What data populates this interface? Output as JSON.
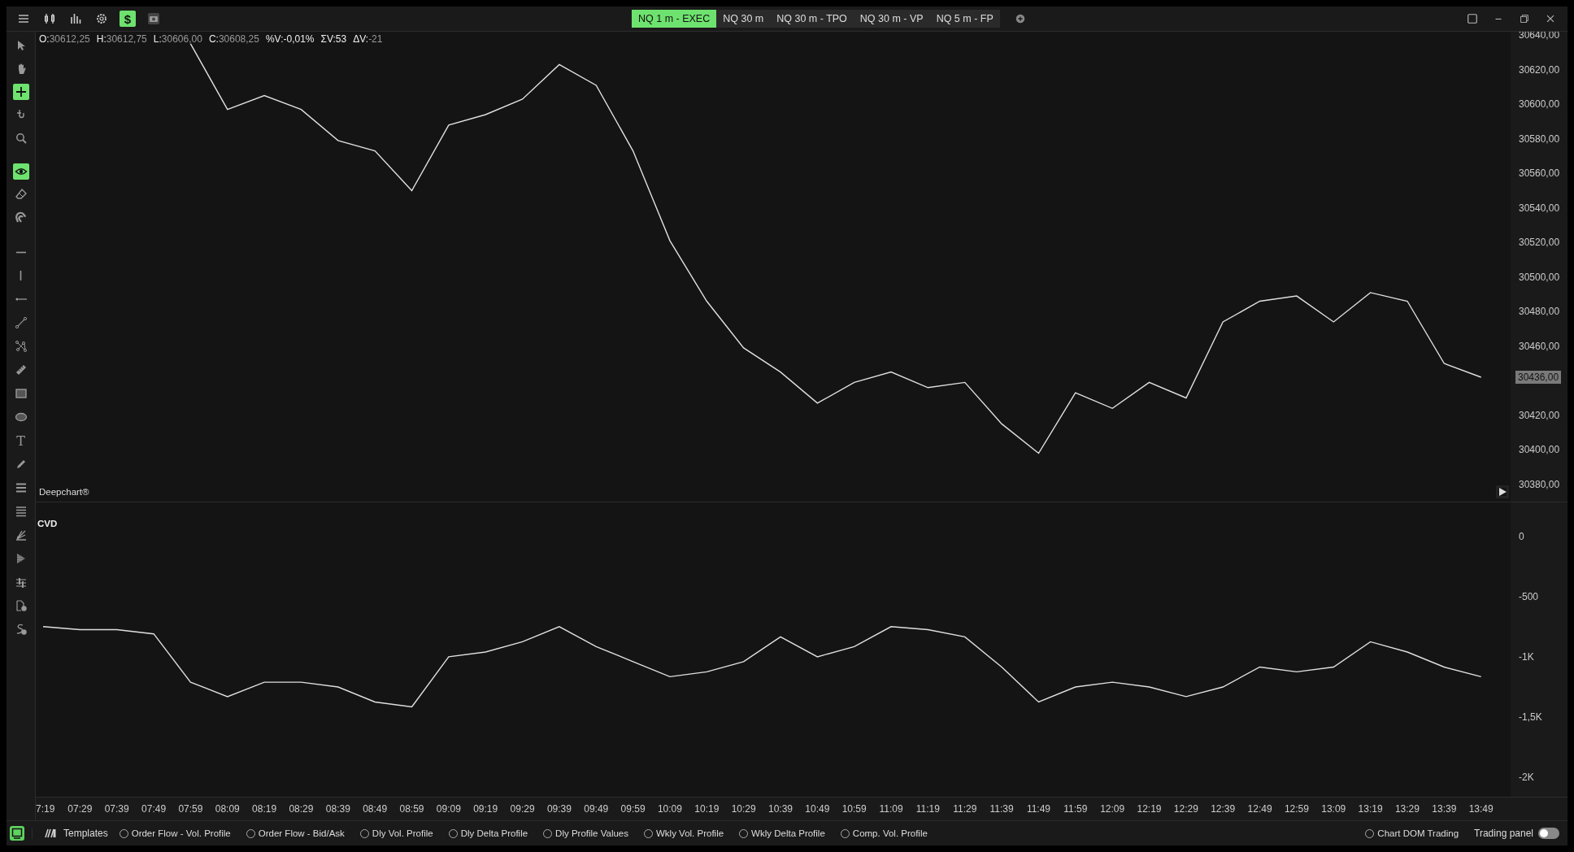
{
  "toolbar": {
    "buttons": [
      {
        "kind": "menu",
        "selected": false
      },
      {
        "kind": "candles",
        "selected": false
      },
      {
        "kind": "bars",
        "selected": false
      },
      {
        "kind": "gear",
        "selected": false
      },
      {
        "kind": "glyph",
        "glyph": "$",
        "selected": true
      },
      {
        "kind": "camera",
        "selected": false
      }
    ]
  },
  "tabs": [
    {
      "label": "NQ 1 m - EXEC",
      "selected": true
    },
    {
      "label": "NQ 30 m",
      "selected": false
    },
    {
      "label": "NQ 30 m - TPO",
      "selected": false
    },
    {
      "label": "NQ 30 m - VP",
      "selected": false
    },
    {
      "label": "NQ 5 m - FP",
      "selected": false
    }
  ],
  "tools": [
    [
      {
        "kind": "pointer",
        "selected": false
      },
      {
        "kind": "hand",
        "selected": false
      },
      {
        "kind": "crosshair",
        "selected": true
      },
      {
        "kind": "hook",
        "selected": false
      },
      {
        "kind": "zoom",
        "selected": false
      }
    ],
    [
      {
        "kind": "eye",
        "selected": true
      },
      {
        "kind": "eraser",
        "selected": false
      },
      {
        "kind": "magnet",
        "selected": false
      }
    ],
    [
      {
        "kind": "hline",
        "selected": false
      },
      {
        "kind": "vline",
        "selected": false
      },
      {
        "kind": "ray",
        "selected": false
      },
      {
        "kind": "trendline",
        "selected": false
      },
      {
        "kind": "polyline",
        "selected": false
      },
      {
        "kind": "ruler",
        "selected": false
      },
      {
        "kind": "rectangle",
        "selected": false
      },
      {
        "kind": "ellipse",
        "selected": false
      },
      {
        "kind": "glyph",
        "glyph": "T",
        "selected": false
      },
      {
        "kind": "pencil",
        "selected": false
      },
      {
        "kind": "lines",
        "selected": false
      },
      {
        "kind": "lines4",
        "selected": false
      },
      {
        "kind": "fan",
        "selected": false
      },
      {
        "kind": "flag",
        "selected": false
      },
      {
        "kind": "levels",
        "selected": false
      },
      {
        "kind": "doc",
        "selected": false
      },
      {
        "kind": "curve",
        "selected": false
      }
    ]
  ],
  "legend": [
    {
      "label": "O:",
      "value": "30612,25",
      "bright": false
    },
    {
      "label": "H:",
      "value": "30612,75",
      "bright": false
    },
    {
      "label": "L:",
      "value": "30606,00",
      "bright": false
    },
    {
      "label": "C:",
      "value": "30608,25",
      "bright": false
    },
    {
      "label": "%V:",
      "value": "-0,01%",
      "bright": true
    },
    {
      "label": "ΣV:",
      "value": "53",
      "bright": true
    },
    {
      "label": "ΔV:",
      "value": "-21",
      "bright": false
    }
  ],
  "price_pane": {
    "title": "Deepchart®",
    "current_price": "30436,00",
    "chart_data": {
      "type": "line",
      "series": [
        {
          "color": "#e0e0e0",
          "values": [
            null,
            null,
            null,
            null,
            30635,
            30597,
            30605,
            30597,
            30579,
            30573,
            30550,
            30588,
            30594,
            30603,
            30623,
            30611,
            30573,
            30521,
            30486,
            30459,
            30445,
            30427,
            30439,
            30445,
            30436,
            30439,
            30415,
            30398,
            30433,
            30424,
            30439,
            30430,
            30474,
            30486,
            30489,
            30474,
            30491,
            30486,
            30450,
            30442
          ]
        }
      ],
      "ylim": [
        30370,
        30642
      ],
      "yticks": [
        {
          "value": 30640,
          "label": "30640,00"
        },
        {
          "value": 30620,
          "label": "30620,00"
        },
        {
          "value": 30600,
          "label": "30600,00"
        },
        {
          "value": 30580,
          "label": "30580,00"
        },
        {
          "value": 30560,
          "label": "30560,00"
        },
        {
          "value": 30540,
          "label": "30540,00"
        },
        {
          "value": 30520,
          "label": "30520,00"
        },
        {
          "value": 30500,
          "label": "30500,00"
        },
        {
          "value": 30480,
          "label": "30480,00"
        },
        {
          "value": 30460,
          "label": "30460,00"
        },
        {
          "value": 30420,
          "label": "30420,00"
        },
        {
          "value": 30400,
          "label": "30400,00"
        },
        {
          "value": 30380,
          "label": "30380,00"
        }
      ]
    }
  },
  "cvd_pane": {
    "title": "CVD",
    "chart_data": {
      "type": "line",
      "categories": [
        "7:19",
        "07:29",
        "07:39",
        "07:49",
        "07:59",
        "08:09",
        "08:19",
        "08:29",
        "08:39",
        "08:49",
        "08:59",
        "09:09",
        "09:19",
        "09:29",
        "09:39",
        "09:49",
        "09:59",
        "10:09",
        "10:19",
        "10:29",
        "10:39",
        "10:49",
        "10:59",
        "11:09",
        "11:19",
        "11:29",
        "11:39",
        "11:49",
        "11:59",
        "12:09",
        "12:19",
        "12:29",
        "12:39",
        "12:49",
        "12:59",
        "13:09",
        "13:19",
        "13:29",
        "13:39",
        "13:49"
      ],
      "series": [
        {
          "color": "#e0e0e0",
          "values": [
            -750,
            -775,
            -775,
            -810,
            -1210,
            -1330,
            -1210,
            -1210,
            -1250,
            -1375,
            -1415,
            -1000,
            -960,
            -875,
            -750,
            -915,
            -1040,
            -1165,
            -1125,
            -1040,
            -835,
            -1000,
            -915,
            -750,
            -775,
            -835,
            -1085,
            -1375,
            -1250,
            -1210,
            -1250,
            -1330,
            -1250,
            -1085,
            -1125,
            -1085,
            -875,
            -960,
            -1085,
            -1165
          ]
        }
      ],
      "ylim": [
        -2160,
        280
      ],
      "yticks": [
        {
          "value": 0,
          "label": "0"
        },
        {
          "value": -500,
          "label": "-500"
        },
        {
          "value": -1000,
          "label": "-1K"
        },
        {
          "value": -1500,
          "label": "-1,5K"
        },
        {
          "value": -2000,
          "label": "-2K"
        }
      ]
    }
  },
  "bottom_bar": {
    "templates_label": "Templates",
    "options": [
      {
        "label": "Order Flow - Vol. Profile",
        "checked": false
      },
      {
        "label": "Order Flow - Bid/Ask",
        "checked": false
      },
      {
        "label": "Dly Vol. Profile",
        "checked": false
      },
      {
        "label": "Dly Delta Profile",
        "checked": false
      },
      {
        "label": "Dly Profile Values",
        "checked": false
      },
      {
        "label": "Wkly Vol. Profile",
        "checked": false
      },
      {
        "label": "Wkly Delta Profile",
        "checked": false
      },
      {
        "label": "Comp. Vol. Profile",
        "checked": false
      }
    ],
    "dom_option": {
      "label": "Chart DOM Trading",
      "checked": false
    },
    "trading_panel": {
      "label": "Trading panel",
      "on": false
    }
  }
}
